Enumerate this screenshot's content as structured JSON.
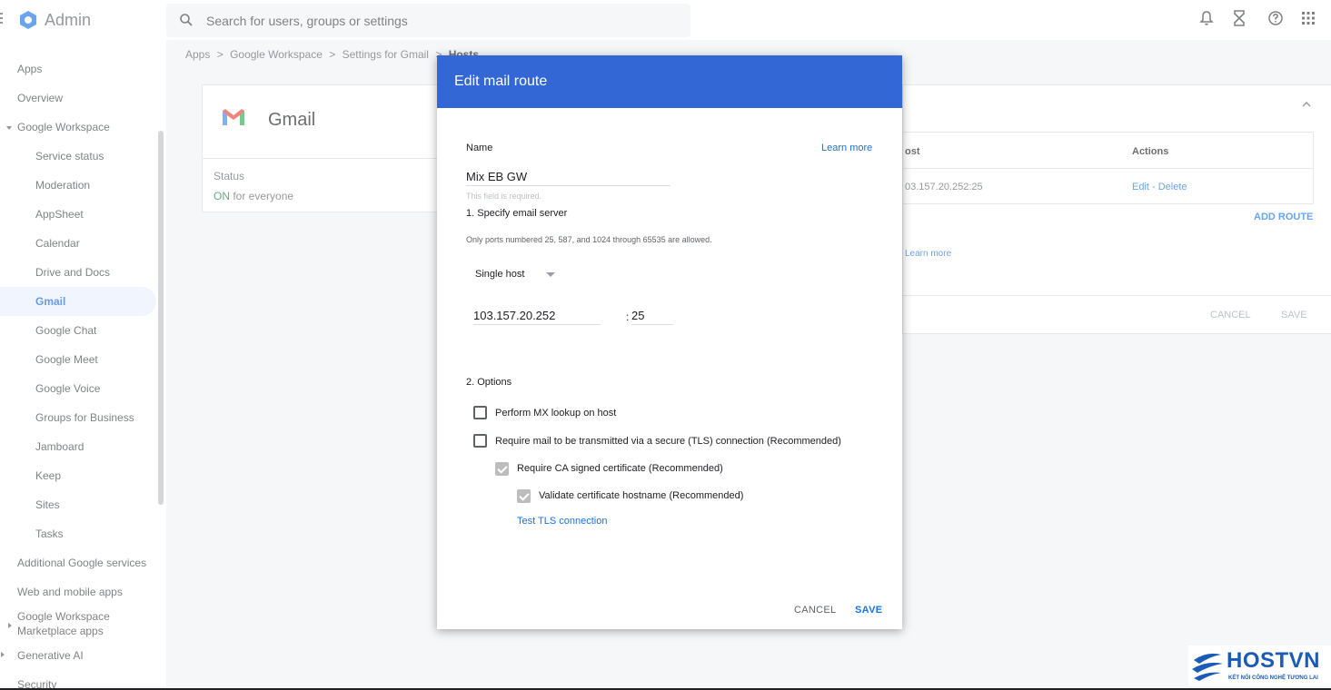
{
  "app": {
    "title": "Admin"
  },
  "search": {
    "placeholder": "Search for users, groups or settings"
  },
  "topbar_icons": [
    "bell-icon",
    "hourglass-icon",
    "help-icon",
    "apps-grid-icon"
  ],
  "sidebar": {
    "items": [
      {
        "label": "Apps",
        "level": "top"
      },
      {
        "label": "Overview",
        "level": "top"
      },
      {
        "label": "Google Workspace",
        "level": "top",
        "expanded": true
      },
      {
        "label": "Service status",
        "level": "sub"
      },
      {
        "label": "Moderation",
        "level": "sub"
      },
      {
        "label": "AppSheet",
        "level": "sub"
      },
      {
        "label": "Calendar",
        "level": "sub"
      },
      {
        "label": "Drive and Docs",
        "level": "sub"
      },
      {
        "label": "Gmail",
        "level": "sub",
        "active": true
      },
      {
        "label": "Google Chat",
        "level": "sub"
      },
      {
        "label": "Google Meet",
        "level": "sub"
      },
      {
        "label": "Google Voice",
        "level": "sub"
      },
      {
        "label": "Groups for Business",
        "level": "sub"
      },
      {
        "label": "Jamboard",
        "level": "sub"
      },
      {
        "label": "Keep",
        "level": "sub"
      },
      {
        "label": "Sites",
        "level": "sub"
      },
      {
        "label": "Tasks",
        "level": "sub"
      },
      {
        "label": "Additional Google services",
        "level": "top"
      },
      {
        "label": "Web and mobile apps",
        "level": "top"
      },
      {
        "label": "Google Workspace",
        "level": "top"
      },
      {
        "label": "Marketplace apps",
        "level": "top"
      },
      {
        "label": "Generative AI",
        "level": "top"
      },
      {
        "label": "Security",
        "level": "top"
      }
    ]
  },
  "breadcrumb": {
    "items": [
      "Apps",
      "Google Workspace",
      "Settings for Gmail"
    ],
    "current": "Hosts",
    "separator": ">"
  },
  "gmail_card": {
    "title": "Gmail",
    "status_label": "Status",
    "status_on": "ON",
    "status_rest": " for everyone"
  },
  "routes_card": {
    "col_host": "ost",
    "col_actions": "Actions",
    "row_host": "03.157.20.252:25",
    "row_actions": "Edit - Delete",
    "add_route": "ADD ROUTE",
    "learn_more": "Learn more",
    "cancel": "CANCEL",
    "save": "SAVE"
  },
  "dialog": {
    "title": "Edit mail route",
    "name_label": "Name",
    "learn_more": "Learn more",
    "name_value": "Mix EB GW",
    "name_hint": "This field is required.",
    "section1": "1. Specify email server",
    "ports_hint": "Only ports numbered 25, 587, and 1024 through 65535 are allowed.",
    "host_type": "Single host",
    "host_value": "103.157.20.252",
    "port_prefix": ":",
    "port_value": "25",
    "section2": "2. Options",
    "opt_mx": "Perform MX lookup on host",
    "opt_tls": "Require mail to be transmitted via a secure (TLS) connection (Recommended)",
    "opt_ca": "Require CA signed certificate (Recommended)",
    "opt_hostname": "Validate certificate hostname (Recommended)",
    "test_tls": "Test TLS connection",
    "cancel": "CANCEL",
    "save": "SAVE",
    "opt_mx_checked": false,
    "opt_tls_checked": false,
    "opt_ca_checked": true,
    "opt_hostname_checked": true
  },
  "watermark": {
    "brand": "HOSTVN",
    "tagline": "KẾT NỐI CÔNG NGHỆ TƯƠNG LAI"
  },
  "colors": {
    "dialog_header": "#3367d6",
    "link": "#1a73e8",
    "status_on": "#188038",
    "active_nav_bg": "#e8f0fe"
  }
}
